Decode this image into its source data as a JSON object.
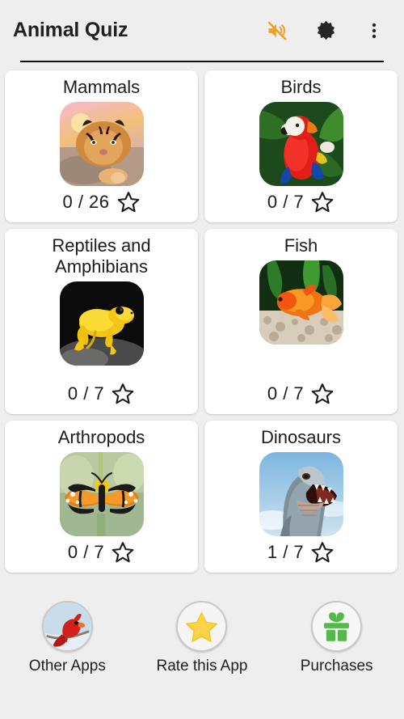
{
  "header": {
    "title": "Animal Quiz",
    "actions": [
      {
        "name": "sound-off-icon",
        "label": "Sound off",
        "color": "#f0a028"
      },
      {
        "name": "brightness-icon",
        "label": "Brightness",
        "color": "#262626"
      },
      {
        "name": "overflow-menu-icon",
        "label": "More options",
        "color": "#262626"
      }
    ]
  },
  "grid": {
    "cards": [
      {
        "title": "Mammals",
        "score": "0 / 26",
        "solved": 0,
        "total": 26,
        "star": "star-outline-icon",
        "image": "tiger-photo"
      },
      {
        "title": "Birds",
        "score": "0 / 7",
        "solved": 0,
        "total": 7,
        "star": "star-outline-icon",
        "image": "macaw-photo"
      },
      {
        "title": "Reptiles and Amphibians",
        "score": "0 / 7",
        "solved": 0,
        "total": 7,
        "star": "star-outline-icon",
        "image": "golden-frog-photo"
      },
      {
        "title": "Fish",
        "score": "0 / 7",
        "solved": 0,
        "total": 7,
        "star": "star-outline-icon",
        "image": "goldfish-photo"
      },
      {
        "title": "Arthropods",
        "score": "0 / 7",
        "solved": 0,
        "total": 7,
        "star": "star-outline-icon",
        "image": "monarch-butterfly-photo"
      },
      {
        "title": "Dinosaurs",
        "score": "1 / 7",
        "solved": 1,
        "total": 7,
        "star": "star-outline-icon",
        "image": "tyrannosaurus-photo"
      }
    ]
  },
  "bottom_bar": {
    "items": [
      {
        "label": "Other Apps",
        "icon": "cardinal-bird-icon"
      },
      {
        "label": "Rate this App",
        "icon": "gold-star-icon"
      },
      {
        "label": "Purchases",
        "icon": "green-gift-icon"
      }
    ]
  },
  "colors": {
    "page_background": "#eeeeee",
    "card_background": "#ffffff",
    "text": "#1c1c1c",
    "accent_orange": "#f0a028",
    "gift_green": "#55b84a",
    "star_gold": "#f5c516"
  }
}
